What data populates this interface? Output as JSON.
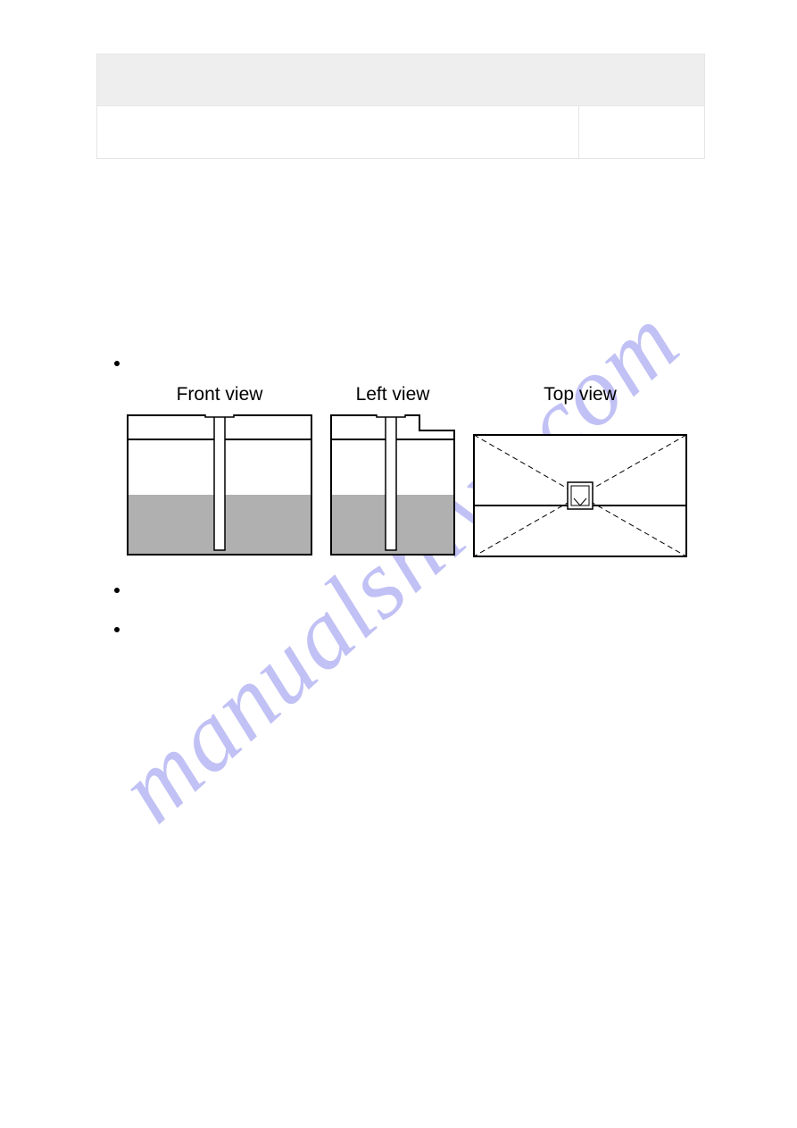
{
  "watermark": "manualshive.com",
  "diagrams": {
    "front_label": "Front view",
    "left_label": "Left view",
    "top_label": "Top view"
  }
}
